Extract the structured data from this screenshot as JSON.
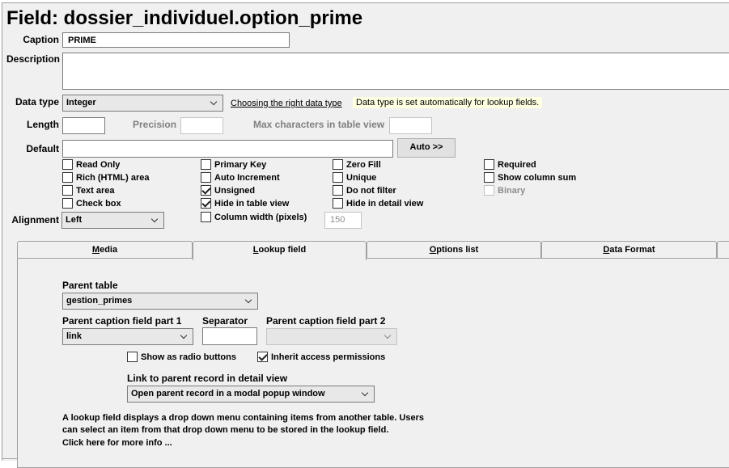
{
  "title": "Field: dossier_individuel.option_prime",
  "caption": {
    "label": "Caption",
    "value": "PRIME"
  },
  "description": {
    "label": "Description",
    "value": ""
  },
  "data_type": {
    "label": "Data type",
    "value": "Integer",
    "help_link": "Choosing the right data type",
    "hint": "Data type is set automatically for lookup fields."
  },
  "length": {
    "label": "Length",
    "value": ""
  },
  "precision": {
    "label": "Precision",
    "value": ""
  },
  "max_chars": {
    "label": "Max characters in table view",
    "value": ""
  },
  "default": {
    "label": "Default",
    "value": "",
    "auto_button": "Auto >>"
  },
  "checkboxes": {
    "read_only": {
      "label": "Read Only",
      "checked": false
    },
    "rich_html": {
      "label": "Rich (HTML) area",
      "checked": false
    },
    "text_area": {
      "label": "Text area",
      "checked": false
    },
    "check_box": {
      "label": "Check box",
      "checked": false
    },
    "primary_key": {
      "label": "Primary Key",
      "checked": false
    },
    "auto_increment": {
      "label": "Auto Increment",
      "checked": false
    },
    "unsigned": {
      "label": "Unsigned",
      "checked": true
    },
    "hide_table_view": {
      "label": "Hide in table view",
      "checked": true
    },
    "column_width": {
      "label": "Column width (pixels)",
      "checked": false
    },
    "zero_fill": {
      "label": "Zero Fill",
      "checked": false
    },
    "unique": {
      "label": "Unique",
      "checked": false
    },
    "do_not_filter": {
      "label": "Do not filter",
      "checked": false
    },
    "hide_detail_view": {
      "label": "Hide in detail view",
      "checked": false
    },
    "required": {
      "label": "Required",
      "checked": false
    },
    "show_column_sum": {
      "label": "Show column sum",
      "checked": false
    },
    "binary": {
      "label": "Binary",
      "checked": false
    }
  },
  "column_width_value": "150",
  "alignment": {
    "label": "Alignment",
    "value": "Left"
  },
  "tabs": [
    {
      "label": "Media",
      "accesskey": "M",
      "rest": "edia",
      "active": false
    },
    {
      "label": "Lookup field",
      "accesskey": "L",
      "rest": "ookup field",
      "active": true
    },
    {
      "label": "Options list",
      "accesskey": "O",
      "rest": "ptions list",
      "active": false
    },
    {
      "label": "Data Format",
      "accesskey": "D",
      "rest": "ata Format",
      "active": false
    }
  ],
  "lookup": {
    "parent_table": {
      "label": "Parent table",
      "value": "gestion_primes"
    },
    "caption_part1": {
      "label": "Parent caption field part 1",
      "value": "link"
    },
    "separator": {
      "label": "Separator",
      "value": ""
    },
    "caption_part2": {
      "label": "Parent caption field part 2",
      "value": ""
    },
    "radio_buttons": {
      "label": "Show as radio buttons",
      "checked": false
    },
    "inherit_permissions": {
      "label": "Inherit access permissions",
      "checked": true
    },
    "link_parent": {
      "label": "Link to parent record in detail view",
      "value": "Open parent record in a modal popup window"
    },
    "info_line1": "A lookup field displays a drop down menu containing items from another table. Users",
    "info_line2": "can select an item from that drop down menu to be stored in the lookup field.",
    "more_info": "Click here for more info ..."
  }
}
